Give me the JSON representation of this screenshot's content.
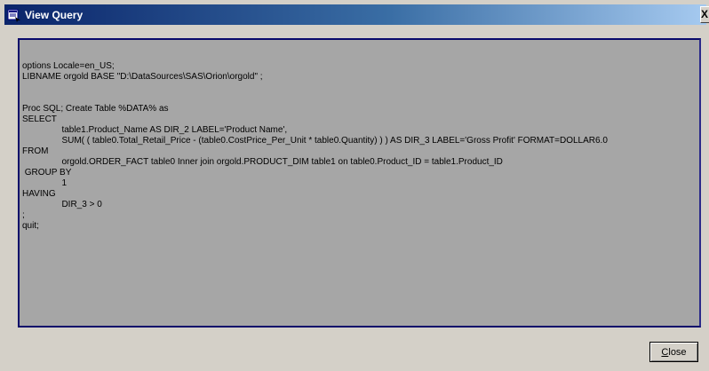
{
  "window": {
    "title": "View Query",
    "close_glyph": "X"
  },
  "query": {
    "lines": [
      "options Locale=en_US;",
      "LIBNAME orgold BASE \"D:\\DataSources\\SAS\\Orion\\orgold\" ;",
      "",
      "",
      "Proc SQL; Create Table %DATA% as",
      "SELECT",
      "                table1.Product_Name AS DIR_2 LABEL='Product Name',",
      "                SUM( ( table0.Total_Retail_Price - (table0.CostPrice_Per_Unit * table0.Quantity) ) ) AS DIR_3 LABEL='Gross Profit' FORMAT=DOLLAR6.0",
      "FROM",
      "                orgold.ORDER_FACT table0 Inner join orgold.PRODUCT_DIM table1 on table0.Product_ID = table1.Product_ID",
      " GROUP BY",
      "                1",
      "HAVING",
      "                DIR_3 > 0",
      ";",
      "quit;"
    ]
  },
  "buttons": {
    "close_first_letter": "C",
    "close_rest": "lose"
  },
  "icons": {
    "title_icon": "query-window-icon"
  }
}
